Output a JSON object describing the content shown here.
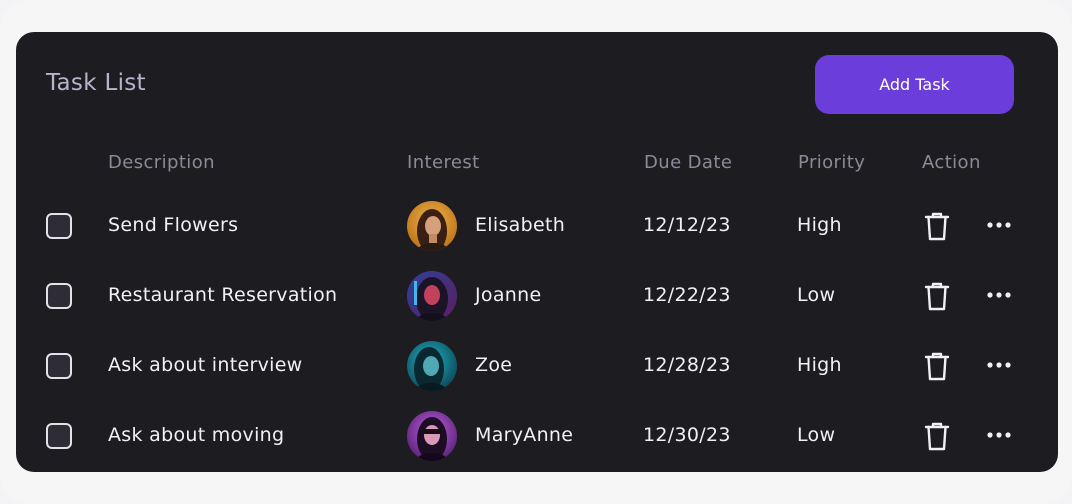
{
  "header": {
    "title": "Task List",
    "add_button_label": "Add Task"
  },
  "columns": {
    "description": "Description",
    "interest": "Interest",
    "due_date": "Due Date",
    "priority": "Priority",
    "action": "Action"
  },
  "tasks": [
    {
      "description": "Send Flowers",
      "person": "Elisabeth",
      "due": "12/12/23",
      "priority": "High",
      "checked": false,
      "avatar": "avatar-elisabeth"
    },
    {
      "description": "Restaurant Reservation",
      "person": "Joanne",
      "due": "12/22/23",
      "priority": "Low",
      "checked": false,
      "avatar": "avatar-joanne"
    },
    {
      "description": "Ask about interview",
      "person": "Zoe",
      "due": "12/28/23",
      "priority": "High",
      "checked": false,
      "avatar": "avatar-zoe"
    },
    {
      "description": "Ask about moving",
      "person": "MaryAnne",
      "due": "12/30/23",
      "priority": "Low",
      "checked": false,
      "avatar": "avatar-maryanne"
    }
  ],
  "icons": {
    "delete": "trash-icon",
    "more": "more-horizontal-icon"
  },
  "colors": {
    "card_background": "#1d1c21",
    "accent": "#6b3ddb",
    "header_text": "#8b8a97",
    "body_text": "#f1f1f4"
  }
}
